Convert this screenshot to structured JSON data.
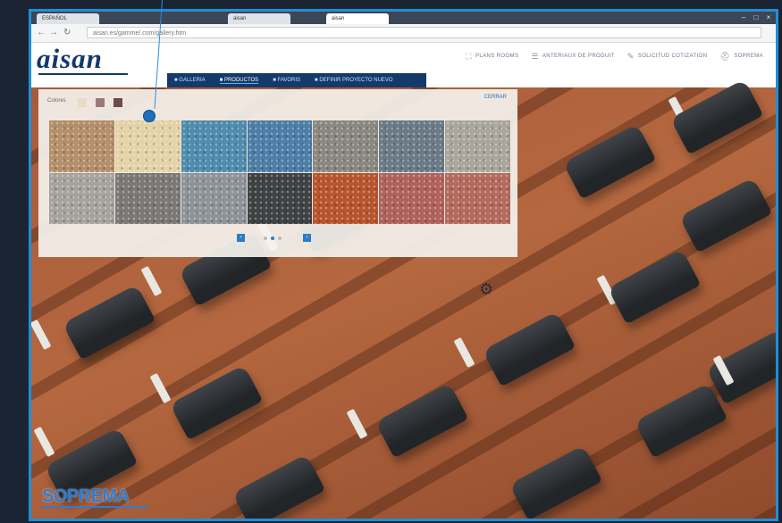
{
  "browser": {
    "tabs": [
      {
        "label": "ESPAÑOL"
      },
      {
        "label": "aisan"
      },
      {
        "label": "aisan"
      }
    ],
    "url": "aisan.es/gamme/.com/gallery.htm"
  },
  "site": {
    "logo_text": "aisan",
    "top_links": [
      {
        "label": "PLANS ROOMS",
        "icon": "expand-icon"
      },
      {
        "label": "ANTERIAUX DE PRODUIT",
        "icon": "list-icon"
      },
      {
        "label": "SOLICITUD COTIZATION",
        "icon": "pen-icon"
      },
      {
        "label": "SOPREMA",
        "icon": "helmet-icon"
      }
    ],
    "nav": [
      {
        "label": "GALLERIA",
        "active": false
      },
      {
        "label": "PRODUCTOS",
        "active": true
      },
      {
        "label": "FAVORIS",
        "active": false
      },
      {
        "label": "DEFINIR PROYECTO NUEVO",
        "active": false
      }
    ]
  },
  "panel": {
    "label": "Colores",
    "link": "CERRAR",
    "small_swatches": [
      "#e8dcc4",
      "#9a7a78",
      "#6a4a4c"
    ],
    "tiles": [
      "#b58f6a",
      "#e4d3a8",
      "#4f8cad",
      "#4d7ea7",
      "#8b8781",
      "#6b7b86",
      "#aaa69c",
      "#a6a39f",
      "#7a7978",
      "#8e939a",
      "#3f4143",
      "#b8552d",
      "#b0615e",
      "#b66a5e"
    ]
  },
  "brand": {
    "footer_logo": "SOPREMA"
  },
  "colors": {
    "accent": "#1f8fd6",
    "brand": "#14396b"
  }
}
